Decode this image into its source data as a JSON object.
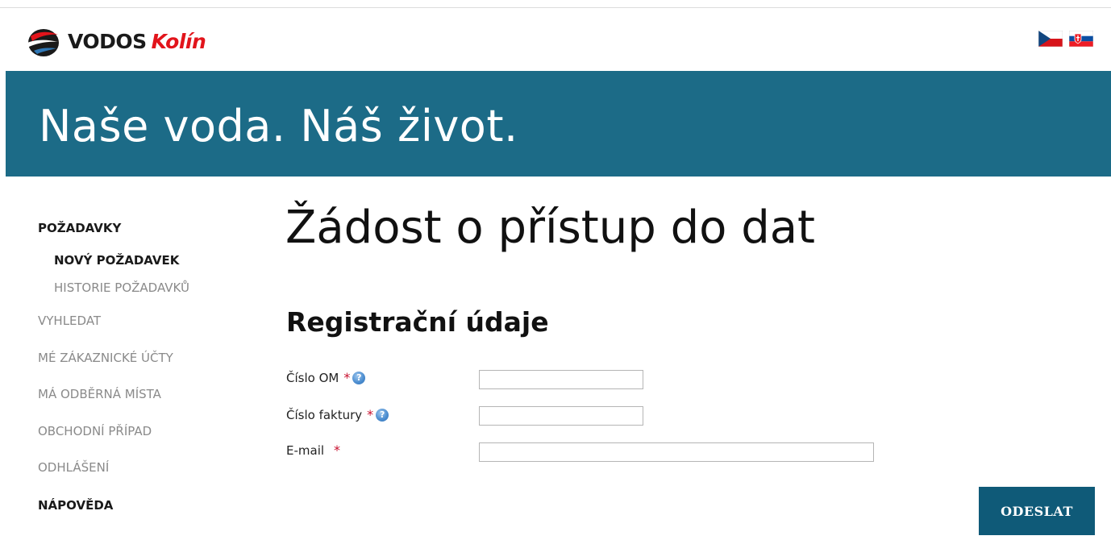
{
  "header": {
    "brand_name": "VODOS",
    "brand_city": "Kolín",
    "logo_icon": "vodos-drop-logo",
    "languages": [
      {
        "code": "cs",
        "flag_icon": "czech-flag-icon"
      },
      {
        "code": "sk",
        "flag_icon": "slovak-flag-icon"
      }
    ]
  },
  "banner": {
    "slogan": "Naše voda. Náš život.",
    "background_color": "#1c6b87"
  },
  "sidebar": {
    "items": [
      {
        "label": "POŽADAVKY",
        "active": true,
        "level": 0
      },
      {
        "label": "NOVÝ POŽADAVEK",
        "active": true,
        "level": 1
      },
      {
        "label": "HISTORIE POŽADAVKŮ",
        "active": false,
        "level": 1
      },
      {
        "label": "VYHLEDAT",
        "active": false,
        "level": 0
      },
      {
        "label": "MÉ ZÁKAZNICKÉ ÚČTY",
        "active": false,
        "level": 0
      },
      {
        "label": "MÁ ODBĚRNÁ MÍSTA",
        "active": false,
        "level": 0
      },
      {
        "label": "OBCHODNÍ PŘÍPAD",
        "active": false,
        "level": 0
      },
      {
        "label": "ODHLÁŠENÍ",
        "active": false,
        "level": 0
      },
      {
        "label": "NÁPOVĚDA",
        "active": true,
        "level": 0
      }
    ]
  },
  "main": {
    "page_title": "Žádost o přístup do dat",
    "section_title": "Registrační údaje",
    "form": {
      "fields": [
        {
          "label": "Číslo OM",
          "required_mark": "*",
          "has_help": true,
          "value": ""
        },
        {
          "label": "Číslo faktury",
          "required_mark": "*",
          "has_help": true,
          "value": ""
        },
        {
          "label": "E-mail",
          "required_mark": "*",
          "has_help": false,
          "value": ""
        }
      ],
      "submit_label": "ODESLAT"
    }
  },
  "colors": {
    "accent": "#1c6b87",
    "button": "#0f5a78",
    "required": "#c8102e",
    "brand_red": "#e2141b"
  }
}
